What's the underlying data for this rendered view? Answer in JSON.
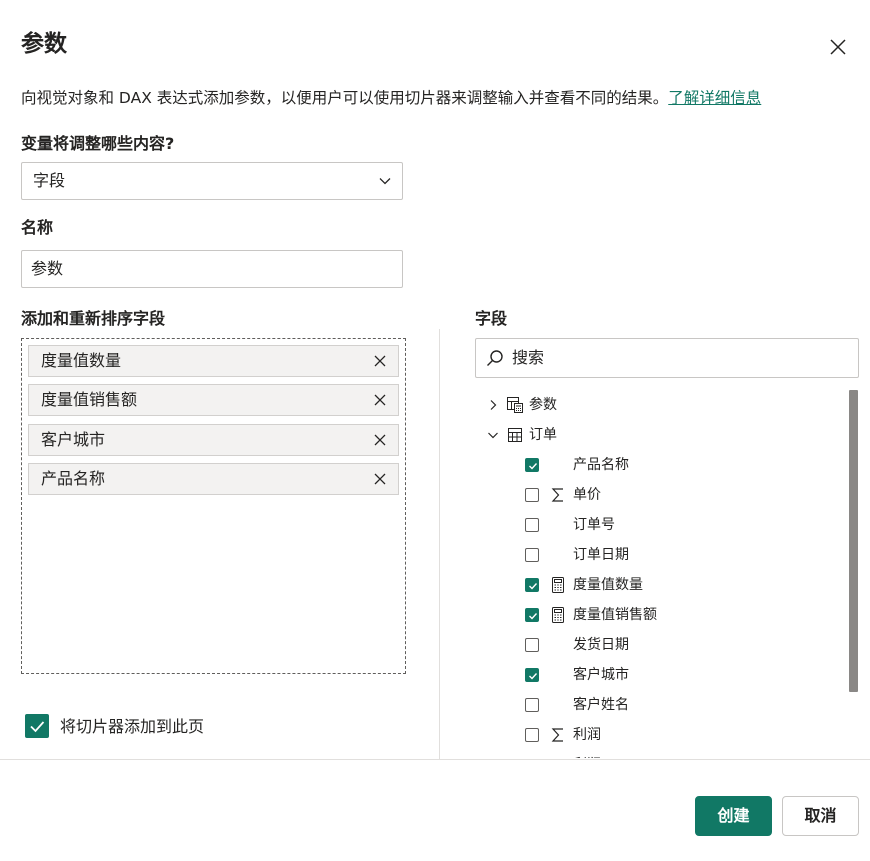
{
  "dialog": {
    "title": "参数",
    "description": "向视觉对象和 DAX 表达式添加参数，以便用户可以使用切片器来调整输入并查看不同的结果。",
    "learn_more": "了解详细信息"
  },
  "variable": {
    "label": "变量将调整哪些内容?",
    "selected": "字段"
  },
  "name": {
    "label": "名称",
    "value": "参数"
  },
  "reorder": {
    "label": "添加和重新排序字段",
    "items": [
      "度量值数量",
      "度量值销售额",
      "客户城市",
      "产品名称"
    ]
  },
  "slicer_option": {
    "label": "将切片器添加到此页",
    "checked": true
  },
  "fields_panel": {
    "label": "字段",
    "search_placeholder": "搜索",
    "tables": [
      {
        "label": "参数",
        "expanded": false,
        "icon": "calc-table-icon"
      },
      {
        "label": "订单",
        "expanded": true,
        "icon": "table-icon"
      }
    ],
    "fields": [
      {
        "label": "产品名称",
        "checked": true,
        "icon": ""
      },
      {
        "label": "单价",
        "checked": false,
        "icon": "sigma-icon"
      },
      {
        "label": "订单号",
        "checked": false,
        "icon": ""
      },
      {
        "label": "订单日期",
        "checked": false,
        "icon": ""
      },
      {
        "label": "度量值数量",
        "checked": true,
        "icon": "calculator-icon"
      },
      {
        "label": "度量值销售额",
        "checked": true,
        "icon": "calculator-icon"
      },
      {
        "label": "发货日期",
        "checked": false,
        "icon": ""
      },
      {
        "label": "客户城市",
        "checked": true,
        "icon": ""
      },
      {
        "label": "客户姓名",
        "checked": false,
        "icon": ""
      },
      {
        "label": "利润",
        "checked": false,
        "icon": "sigma-icon"
      },
      {
        "label": "利润",
        "checked": false,
        "icon": "sigma-icon"
      }
    ]
  },
  "footer": {
    "create": "创建",
    "cancel": "取消"
  },
  "colors": {
    "accent": "#117865",
    "text": "#252423",
    "border": "#c8c6c4"
  }
}
